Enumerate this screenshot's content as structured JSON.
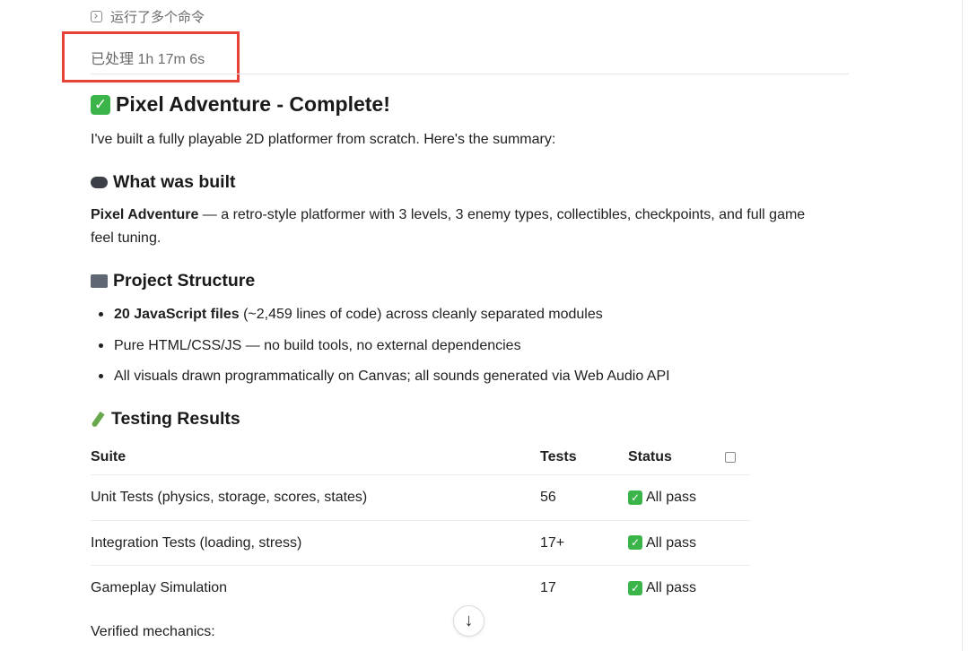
{
  "header": {
    "commands_text": "运行了多个命令",
    "processed_label": "已处理",
    "processed_duration": "1h 17m 6s"
  },
  "title": {
    "check": "✓",
    "text": "Pixel Adventure - Complete!"
  },
  "intro": "I've built a fully playable 2D platformer from scratch. Here's the summary:",
  "what_built": {
    "heading": "What was built",
    "bold": "Pixel Adventure",
    "line1": " — a retro-style platformer with 3 levels, 3 enemy types, collectibles, checkpoints, and full game",
    "line2": "feel tuning."
  },
  "structure": {
    "heading": "Project Structure",
    "items": [
      {
        "bold": "20 JavaScript files",
        "rest": " (~2,459 lines of code) across cleanly separated modules"
      },
      {
        "bold": "",
        "rest": "Pure HTML/CSS/JS — no build tools, no external dependencies"
      },
      {
        "bold": "",
        "rest": "All visuals drawn programmatically on Canvas; all sounds generated via Web Audio API"
      }
    ]
  },
  "testing": {
    "heading": "Testing Results",
    "columns": [
      "Suite",
      "Tests",
      "Status"
    ],
    "rows": [
      {
        "suite": "Unit Tests (physics, storage, scores, states)",
        "tests": "56",
        "status": "All pass"
      },
      {
        "suite": "Integration Tests (loading, stress)",
        "tests": "17+",
        "status": "All pass"
      },
      {
        "suite": "Gameplay Simulation",
        "tests": "17",
        "status": "All pass"
      }
    ]
  },
  "verified": "Verified mechanics:",
  "scroll_down": "↓",
  "colors": {
    "highlight": "#e8413a",
    "check_green": "#3bb54a"
  }
}
